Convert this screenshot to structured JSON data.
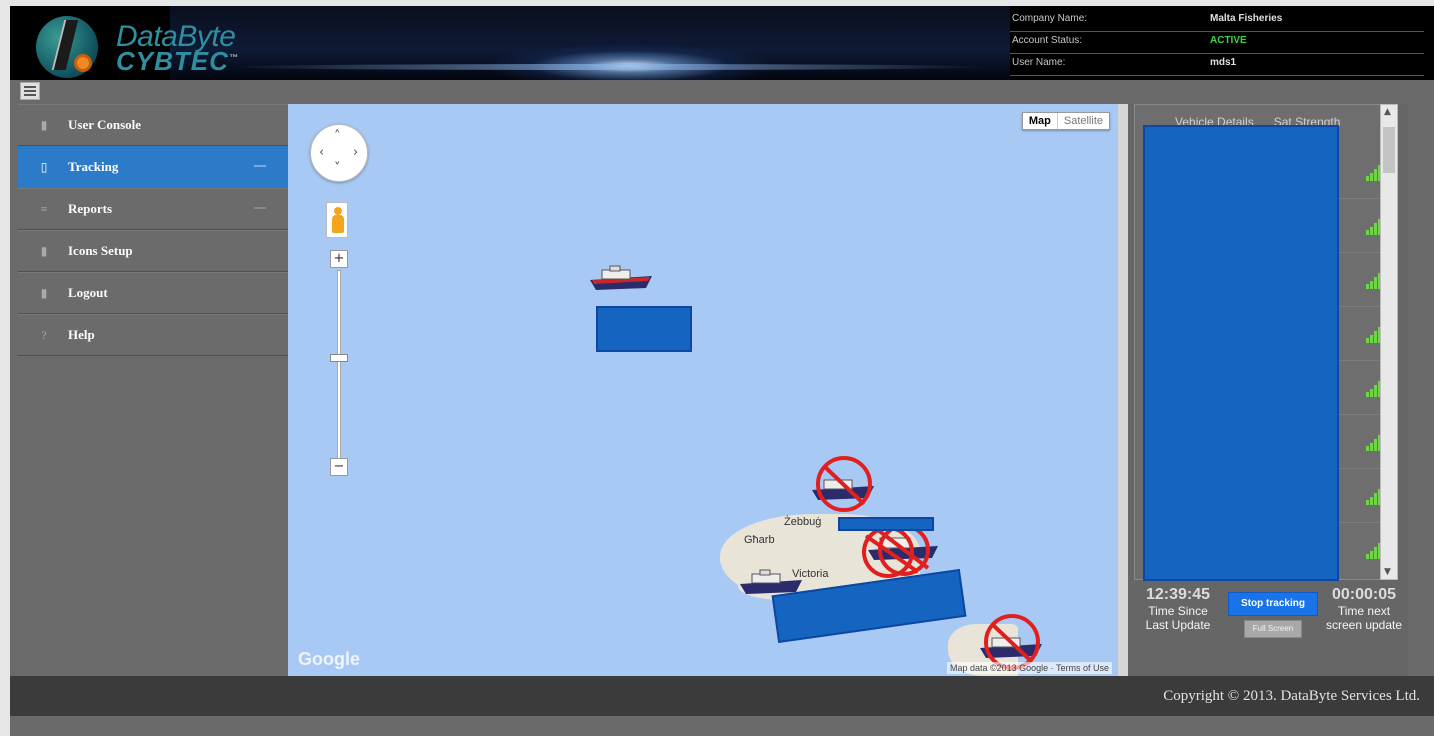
{
  "brand": {
    "name_line1": "DataByte",
    "name_line2": "CYBTEC",
    "tm": "™"
  },
  "account": {
    "company_label": "Company Name:",
    "company_value": "Malta Fisheries",
    "status_label": "Account Status:",
    "status_value": "ACTIVE",
    "user_label": "User Name:",
    "user_value": "mds1"
  },
  "sidebar": {
    "items": [
      {
        "label": "User Console",
        "icon": "user-icon"
      },
      {
        "label": "Tracking",
        "icon": "document-icon",
        "active": true
      },
      {
        "label": "Reports",
        "icon": "list-icon"
      },
      {
        "label": "Icons Setup",
        "icon": "phone-icon"
      },
      {
        "label": "Logout",
        "icon": "user-icon"
      },
      {
        "label": "Help",
        "icon": "question-icon"
      }
    ]
  },
  "map": {
    "type_map": "Map",
    "type_satellite": "Satellite",
    "zoom_in": "+",
    "zoom_out": "−",
    "labels": {
      "zebbug": "Żebbuġ",
      "gharb": "Għarb",
      "victoria": "Victoria"
    },
    "google": "Google",
    "footer": "Map data ©2013 Google · Terms of Use"
  },
  "panel": {
    "tab_vehicle": "Vehicle Details",
    "tab_signal": "Sat Strength",
    "time_since": "12:39:45",
    "time_since_label": "Time Since Last Update",
    "time_next": "00:00:05",
    "time_next_label": "Time next screen update",
    "stop_tracking": "Stop tracking",
    "full_screen": "Full Screen"
  },
  "footer": {
    "copyright": "Copyright © 2013. DataByte Services Ltd."
  },
  "colors": {
    "active_nav": "#2b7bc8",
    "status_active": "#3cd34a",
    "water": "#a9c9f5",
    "redaction": "#1565c0"
  }
}
